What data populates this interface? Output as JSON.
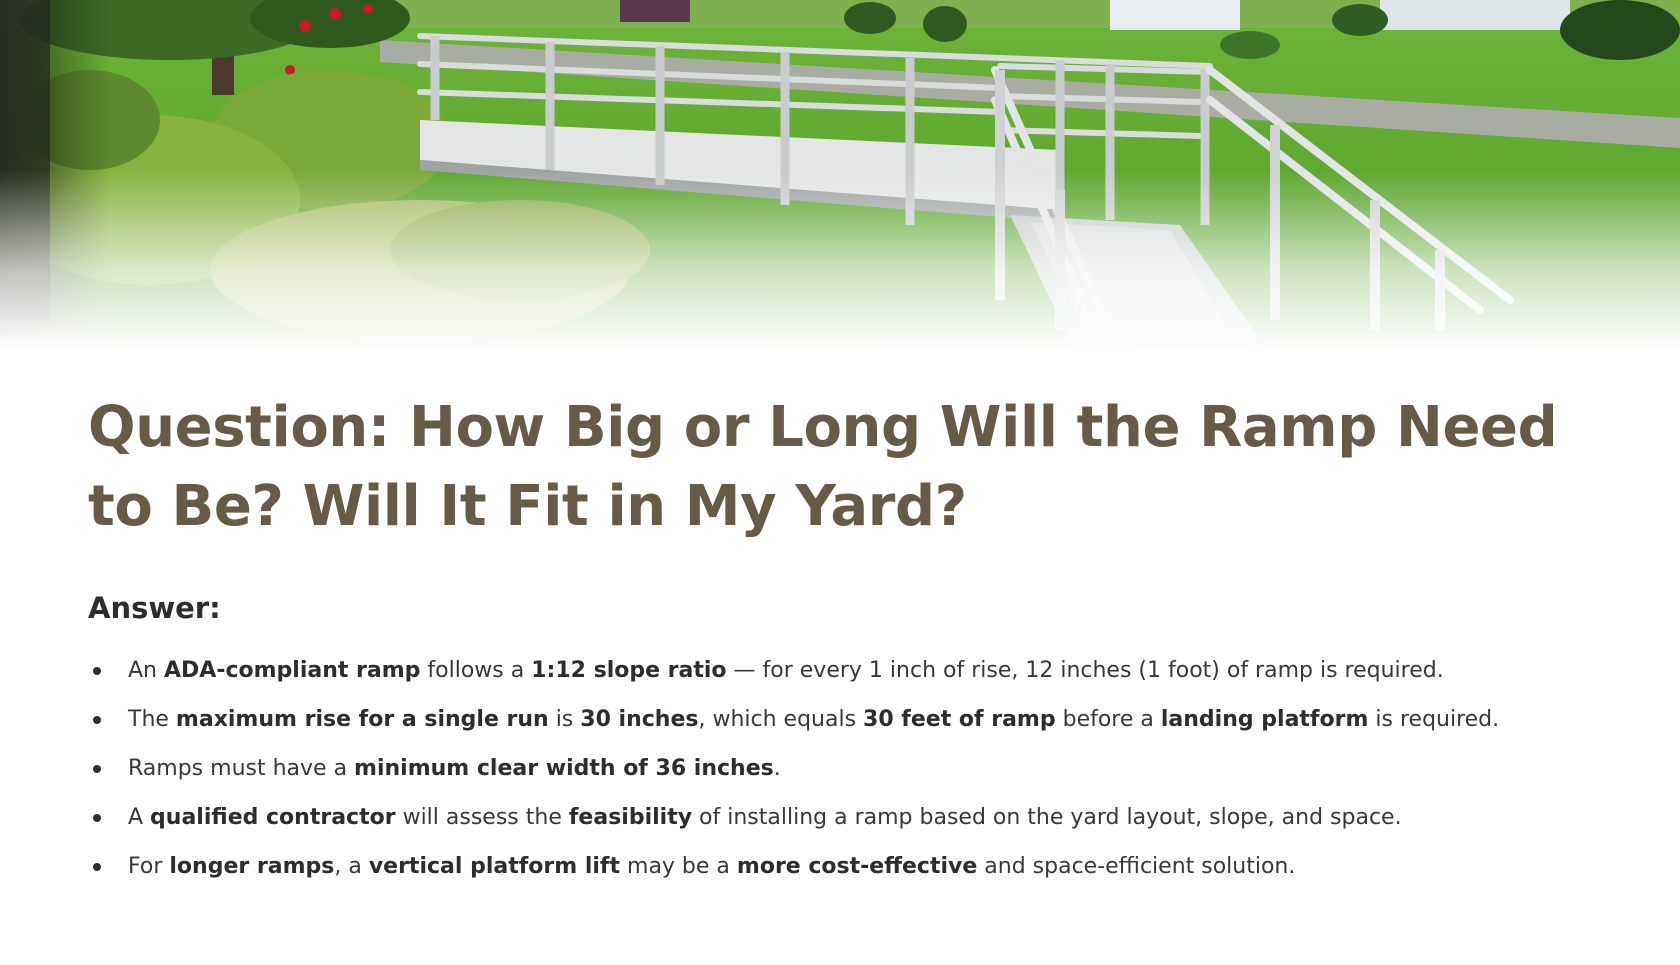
{
  "hero_image": {
    "alt_name": "aluminum wheelchair ramp in green front yard"
  },
  "header": {
    "title": "Question: How Big or Long Will the Ramp Need to Be? Will It Fit in My Yard?"
  },
  "answer": {
    "label": "Answer:",
    "bullets": [
      {
        "segments": [
          {
            "text": "An ",
            "bold": false
          },
          {
            "text": "ADA-compliant ramp",
            "bold": true
          },
          {
            "text": " follows a ",
            "bold": false
          },
          {
            "text": "1:12 slope ratio",
            "bold": true
          },
          {
            "text": " — for every 1 inch of rise, 12 inches (1 foot) of ramp is required.",
            "bold": false
          }
        ]
      },
      {
        "segments": [
          {
            "text": "The ",
            "bold": false
          },
          {
            "text": "maximum rise for a single run",
            "bold": true
          },
          {
            "text": " is ",
            "bold": false
          },
          {
            "text": "30 inches",
            "bold": true
          },
          {
            "text": ", which equals ",
            "bold": false
          },
          {
            "text": "30 feet of ramp",
            "bold": true
          },
          {
            "text": " before a ",
            "bold": false
          },
          {
            "text": "landing platform",
            "bold": true
          },
          {
            "text": " is required.",
            "bold": false
          }
        ]
      },
      {
        "segments": [
          {
            "text": "Ramps must have a ",
            "bold": false
          },
          {
            "text": "minimum clear width of 36 inches",
            "bold": true
          },
          {
            "text": ".",
            "bold": false
          }
        ]
      },
      {
        "segments": [
          {
            "text": "A ",
            "bold": false
          },
          {
            "text": "qualified contractor",
            "bold": true
          },
          {
            "text": " will assess the ",
            "bold": false
          },
          {
            "text": "feasibility",
            "bold": true
          },
          {
            "text": " of installing a ramp based on the yard layout, slope, and space.",
            "bold": false
          }
        ]
      },
      {
        "segments": [
          {
            "text": "For ",
            "bold": false
          },
          {
            "text": "longer ramps",
            "bold": true
          },
          {
            "text": ", a ",
            "bold": false
          },
          {
            "text": "vertical platform lift",
            "bold": true
          },
          {
            "text": " may be a ",
            "bold": false
          },
          {
            "text": "more cost-effective",
            "bold": true
          },
          {
            "text": " and space-efficient solution.",
            "bold": false
          }
        ]
      }
    ]
  },
  "colors": {
    "title": "#675b47",
    "body_text": "#3a3835",
    "strong_text": "#2f2d2a",
    "lawn": "#5fa62f",
    "ramp_metal": "#d7dadb"
  }
}
